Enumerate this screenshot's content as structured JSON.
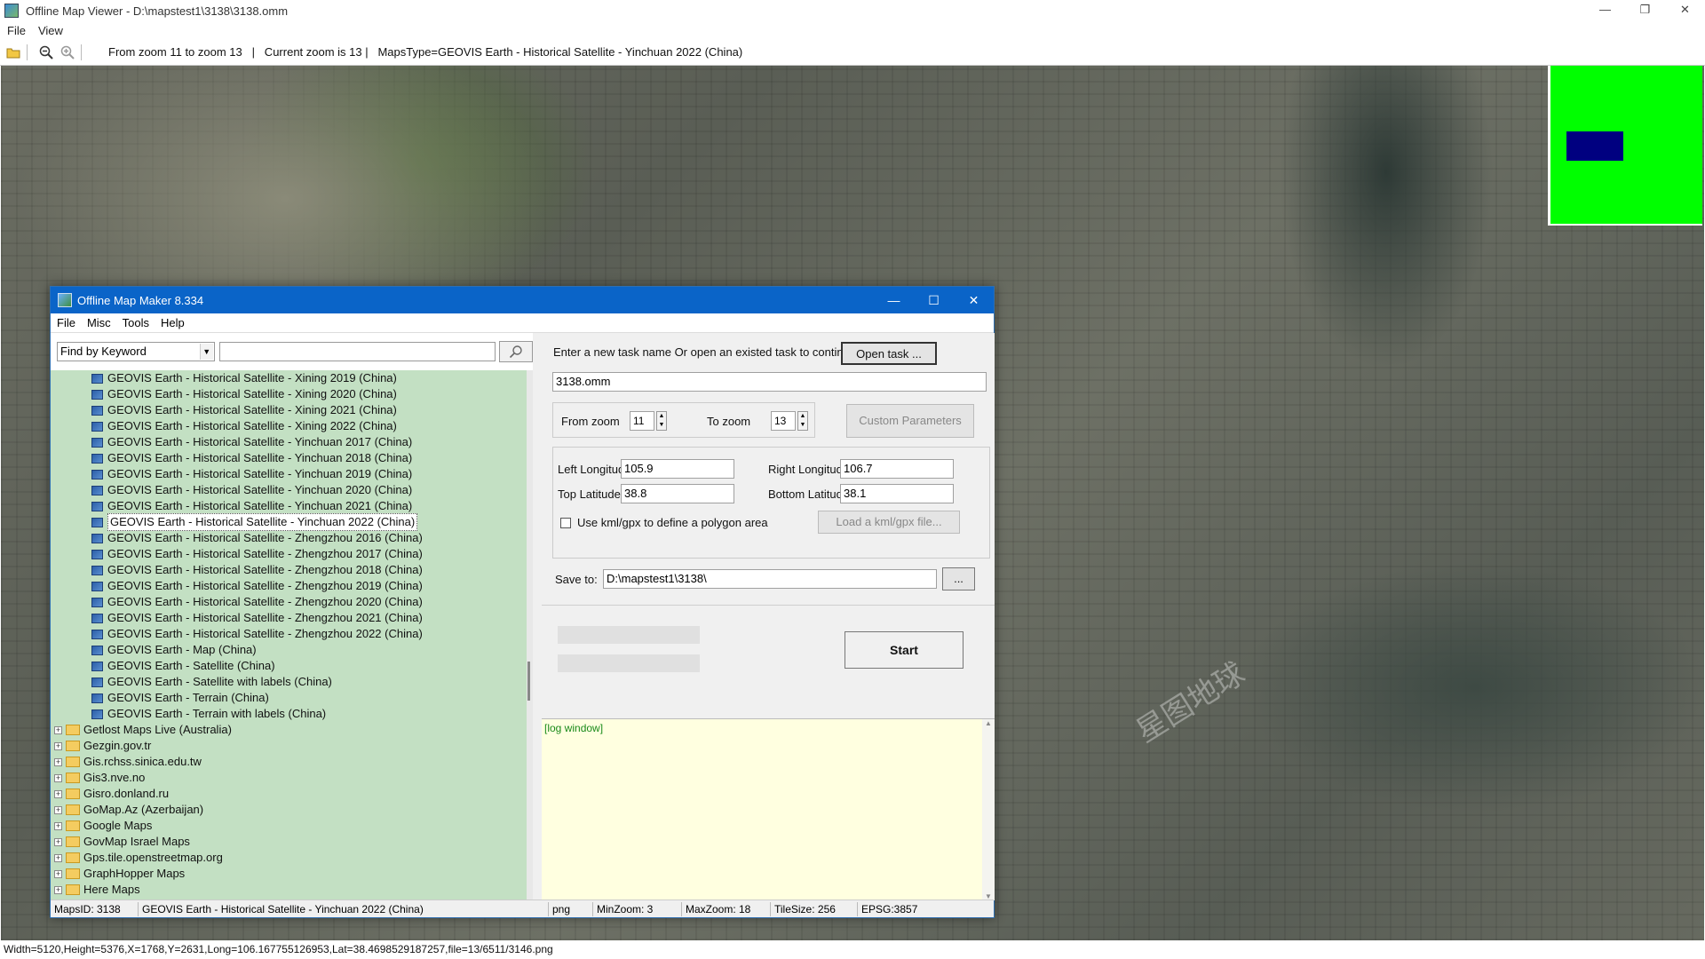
{
  "window": {
    "title": "Offline Map Viewer - D:\\mapstest1\\3138\\3138.omm",
    "minimize": "—",
    "maximize": "❐",
    "close": "✕"
  },
  "menu": [
    "File",
    "View"
  ],
  "toolbar": {
    "info": "From zoom 11 to zoom 13   |   Current zoom is 13 |   MapsType=GEOVIS Earth - Historical Satellite - Yinchuan 2022 (China)"
  },
  "watermark": "星图地球",
  "statusbar": "Width=5120,Height=5376,X=1768,Y=2631,Long=106.167755126953,Lat=38.4698529187257,file=13/6511/3146.png",
  "dialog": {
    "title": "Offline Map Maker 8.334",
    "minimize": "—",
    "maximize": "☐",
    "close": "✕",
    "menu": [
      "File",
      "Misc",
      "Tools",
      "Help"
    ],
    "find_mode": "Find by Keyword",
    "keyword": "",
    "tree": [
      {
        "label": "GEOVIS Earth - Historical Satellite - Xining 2019 (China)",
        "type": "map"
      },
      {
        "label": "GEOVIS Earth - Historical Satellite - Xining 2020 (China)",
        "type": "map"
      },
      {
        "label": "GEOVIS Earth - Historical Satellite - Xining 2021 (China)",
        "type": "map"
      },
      {
        "label": "GEOVIS Earth - Historical Satellite - Xining 2022 (China)",
        "type": "map"
      },
      {
        "label": "GEOVIS Earth - Historical Satellite - Yinchuan 2017 (China)",
        "type": "map"
      },
      {
        "label": "GEOVIS Earth - Historical Satellite - Yinchuan 2018 (China)",
        "type": "map"
      },
      {
        "label": "GEOVIS Earth - Historical Satellite - Yinchuan 2019 (China)",
        "type": "map"
      },
      {
        "label": "GEOVIS Earth - Historical Satellite - Yinchuan 2020 (China)",
        "type": "map"
      },
      {
        "label": "GEOVIS Earth - Historical Satellite - Yinchuan 2021 (China)",
        "type": "map"
      },
      {
        "label": "GEOVIS Earth - Historical Satellite - Yinchuan 2022 (China)",
        "type": "map",
        "selected": true
      },
      {
        "label": "GEOVIS Earth - Historical Satellite - Zhengzhou 2016 (China)",
        "type": "map"
      },
      {
        "label": "GEOVIS Earth - Historical Satellite - Zhengzhou 2017 (China)",
        "type": "map"
      },
      {
        "label": "GEOVIS Earth - Historical Satellite - Zhengzhou 2018 (China)",
        "type": "map"
      },
      {
        "label": "GEOVIS Earth - Historical Satellite - Zhengzhou 2019 (China)",
        "type": "map"
      },
      {
        "label": "GEOVIS Earth - Historical Satellite - Zhengzhou 2020 (China)",
        "type": "map"
      },
      {
        "label": "GEOVIS Earth - Historical Satellite - Zhengzhou 2021 (China)",
        "type": "map"
      },
      {
        "label": "GEOVIS Earth - Historical Satellite - Zhengzhou 2022 (China)",
        "type": "map"
      },
      {
        "label": "GEOVIS Earth - Map (China)",
        "type": "map"
      },
      {
        "label": "GEOVIS Earth - Satellite (China)",
        "type": "map"
      },
      {
        "label": "GEOVIS Earth - Satellite with labels (China)",
        "type": "map"
      },
      {
        "label": "GEOVIS Earth - Terrain (China)",
        "type": "map"
      },
      {
        "label": "GEOVIS Earth - Terrain with labels (China)",
        "type": "map"
      },
      {
        "label": "Getlost Maps Live (Australia)",
        "type": "folder"
      },
      {
        "label": "Gezgin.gov.tr",
        "type": "folder"
      },
      {
        "label": "Gis.rchss.sinica.edu.tw",
        "type": "folder"
      },
      {
        "label": "Gis3.nve.no",
        "type": "folder"
      },
      {
        "label": "Gisro.donland.ru",
        "type": "folder"
      },
      {
        "label": "GoMap.Az (Azerbaijan)",
        "type": "folder"
      },
      {
        "label": "Google Maps",
        "type": "folder"
      },
      {
        "label": "GovMap Israel Maps",
        "type": "folder"
      },
      {
        "label": "Gps.tile.openstreetmap.org",
        "type": "folder"
      },
      {
        "label": "GraphHopper Maps",
        "type": "folder"
      },
      {
        "label": "Here Maps",
        "type": "folder"
      }
    ],
    "task_prompt": "Enter a new task name Or open an existed task to continue:",
    "open_task": "Open task ...",
    "task_name": "3138.omm",
    "from_zoom_label": "From zoom",
    "from_zoom": "11",
    "to_zoom_label": "To zoom",
    "to_zoom": "13",
    "custom_params": "Custom Parameters",
    "left_lon_label": "Left Longitude",
    "left_lon": "105.9",
    "right_lon_label": "Right Longitude",
    "right_lon": "106.7",
    "top_lat_label": "Top Latitude",
    "top_lat": "38.8",
    "bottom_lat_label": "Bottom Latitude",
    "bottom_lat": "38.1",
    "kml_label": "Use kml/gpx to define a polygon area",
    "load_kml": "Load a kml/gpx file...",
    "save_to_label": "Save to:",
    "save_to": "D:\\mapstest1\\3138\\",
    "browse": "...",
    "start": "Start",
    "log_title": "[log window]",
    "status": {
      "maps_id": "MapsID: 3138",
      "map_name": "GEOVIS Earth - Historical Satellite - Yinchuan 2022 (China)",
      "format": "png",
      "min_zoom": "MinZoom: 3",
      "max_zoom": "MaxZoom: 18",
      "tile_size": "TileSize: 256",
      "epsg": "EPSG:3857"
    }
  }
}
